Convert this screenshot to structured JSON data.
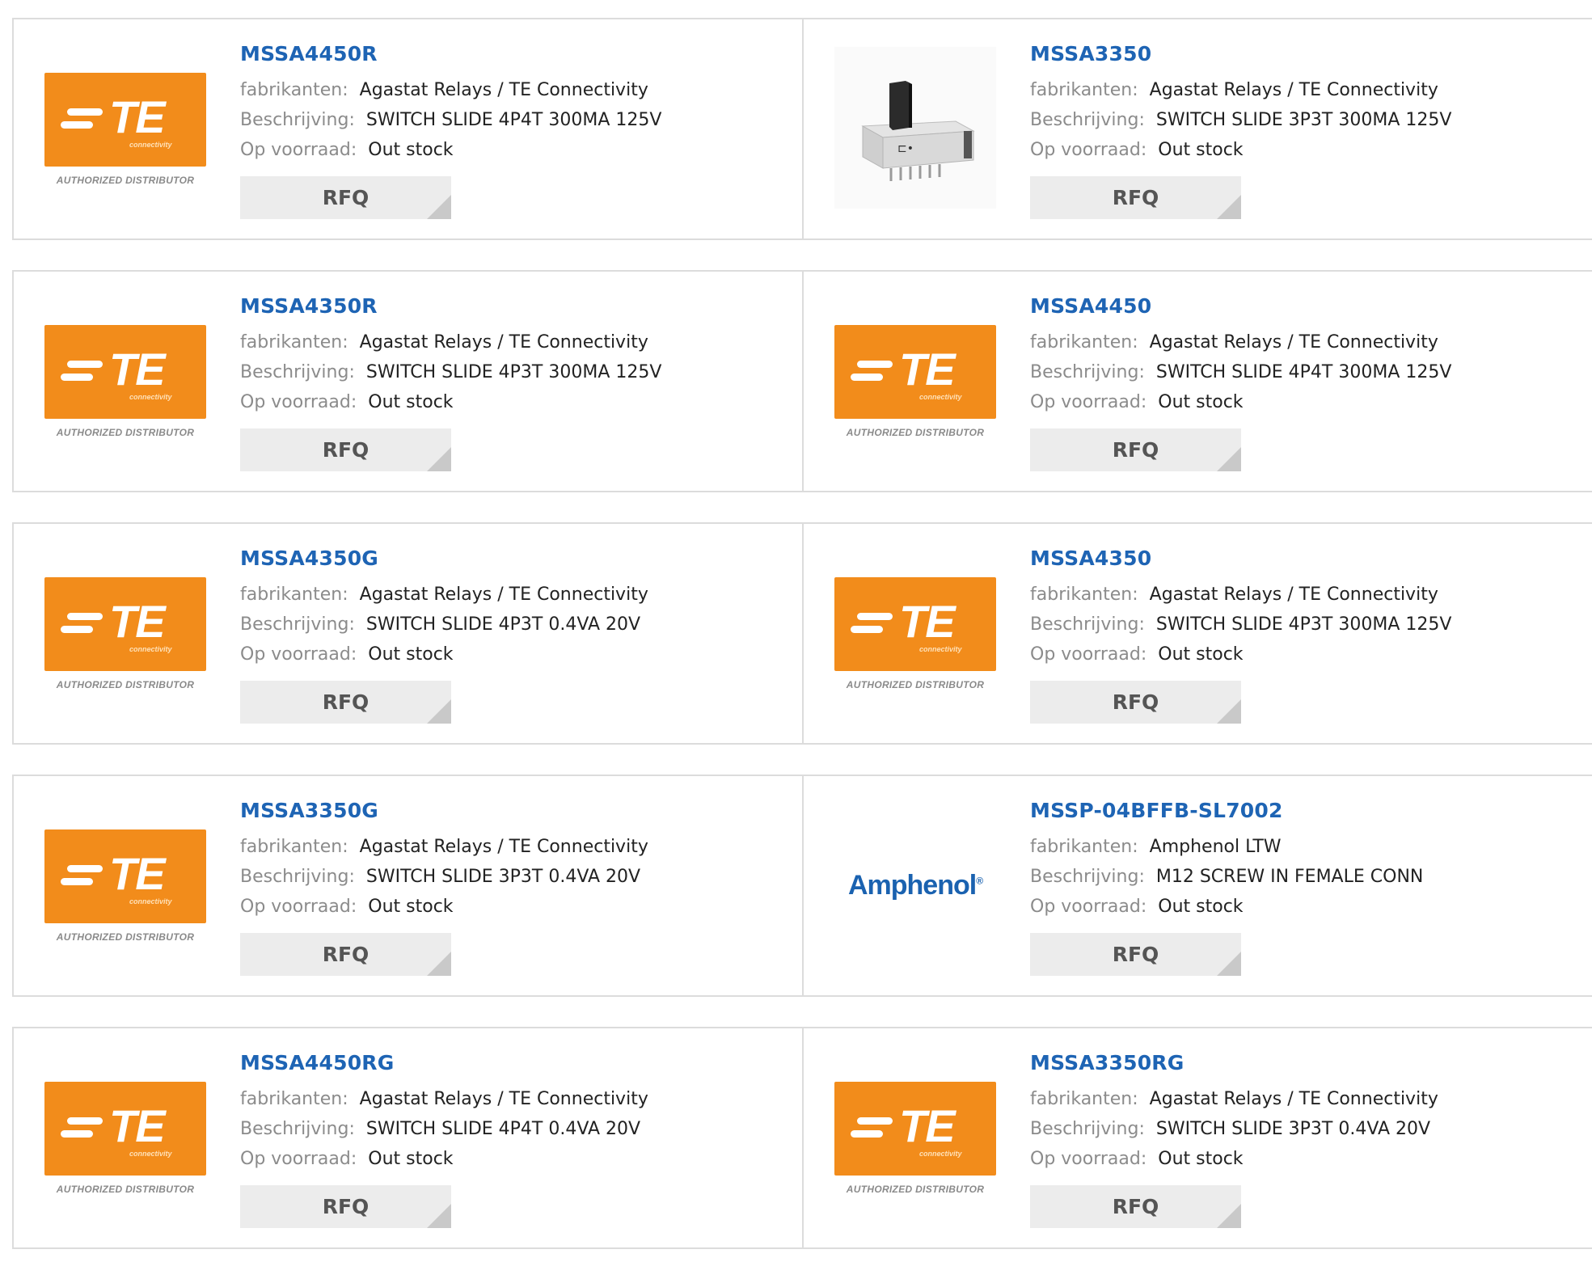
{
  "labels": {
    "manufacturer": "fabrikanten:",
    "description": "Beschrijving:",
    "stock": "Op voorraad:",
    "rfq": "RFQ"
  },
  "logos": {
    "te": {
      "name": "TE",
      "sub": "connectivity",
      "footer": "AUTHORIZED DISTRIBUTOR",
      "color": "#f28c1b"
    },
    "amphenol": {
      "name": "Amphenol",
      "reg": "®",
      "color": "#1a62b0"
    }
  },
  "colors": {
    "link": "#1e64b4",
    "label": "#8b8b8b",
    "button_bg": "#ececec",
    "border": "#dcdcdc"
  },
  "products": [
    {
      "part": "MSSA4450R",
      "manufacturer": "Agastat Relays / TE Connectivity",
      "description": "SWITCH SLIDE 4P4T 300MA 125V",
      "stock": "Out stock",
      "image": "te-logo"
    },
    {
      "part": "MSSA3350",
      "manufacturer": "Agastat Relays / TE Connectivity",
      "description": "SWITCH SLIDE 3P3T 300MA 125V",
      "stock": "Out stock",
      "image": "switch-photo"
    },
    {
      "part": "MSSA4350R",
      "manufacturer": "Agastat Relays / TE Connectivity",
      "description": "SWITCH SLIDE 4P3T 300MA 125V",
      "stock": "Out stock",
      "image": "te-logo"
    },
    {
      "part": "MSSA4450",
      "manufacturer": "Agastat Relays / TE Connectivity",
      "description": "SWITCH SLIDE 4P4T 300MA 125V",
      "stock": "Out stock",
      "image": "te-logo"
    },
    {
      "part": "MSSA4350G",
      "manufacturer": "Agastat Relays / TE Connectivity",
      "description": "SWITCH SLIDE 4P3T 0.4VA 20V",
      "stock": "Out stock",
      "image": "te-logo"
    },
    {
      "part": "MSSA4350",
      "manufacturer": "Agastat Relays / TE Connectivity",
      "description": "SWITCH SLIDE 4P3T 300MA 125V",
      "stock": "Out stock",
      "image": "te-logo"
    },
    {
      "part": "MSSA3350G",
      "manufacturer": "Agastat Relays / TE Connectivity",
      "description": "SWITCH SLIDE 3P3T 0.4VA 20V",
      "stock": "Out stock",
      "image": "te-logo"
    },
    {
      "part": "MSSP-04BFFB-SL7002",
      "manufacturer": "Amphenol LTW",
      "description": "M12 SCREW IN FEMALE CONN",
      "stock": "Out stock",
      "image": "amphenol-logo"
    },
    {
      "part": "MSSA4450RG",
      "manufacturer": "Agastat Relays / TE Connectivity",
      "description": "SWITCH SLIDE 4P4T 0.4VA 20V",
      "stock": "Out stock",
      "image": "te-logo"
    },
    {
      "part": "MSSA3350RG",
      "manufacturer": "Agastat Relays / TE Connectivity",
      "description": "SWITCH SLIDE 3P3T 0.4VA 20V",
      "stock": "Out stock",
      "image": "te-logo"
    }
  ]
}
